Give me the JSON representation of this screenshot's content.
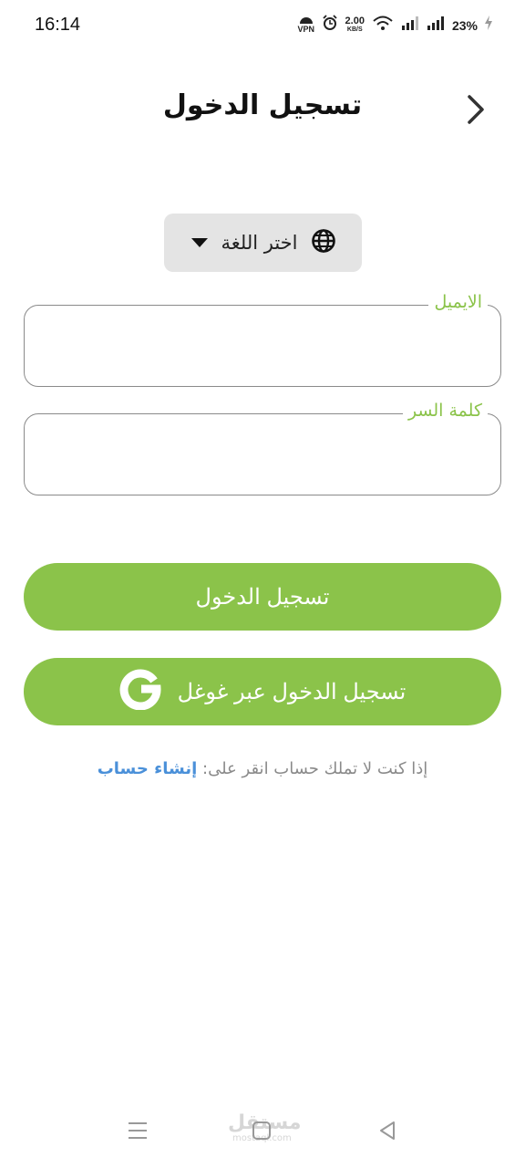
{
  "status_bar": {
    "time": "16:14",
    "vpn": "VPN",
    "speed_value": "2.00",
    "speed_unit": "KB/S",
    "battery": "23%"
  },
  "header": {
    "title": "تسجيل الدخول",
    "back_icon": "chevron-right-icon"
  },
  "language": {
    "label": "اختر اللغة",
    "icon": "globe-icon",
    "dropdown_icon": "caret-down-icon"
  },
  "form": {
    "email_label": "الايميل",
    "email_value": "",
    "password_label": "كلمة السر",
    "password_value": ""
  },
  "actions": {
    "login_label": "تسجيل الدخول",
    "google_label": "تسجيل الدخول عبر غوغل",
    "google_icon": "google-g-icon"
  },
  "signup": {
    "prompt": "إذا كنت لا تملك حساب انقر على:",
    "link": "إنشاء حساب"
  },
  "watermark": {
    "text": "مستقل",
    "sub": "mostaql.com"
  },
  "colors": {
    "accent": "#8bc34a",
    "link": "#4a90d9",
    "muted": "#8a8a8a"
  }
}
